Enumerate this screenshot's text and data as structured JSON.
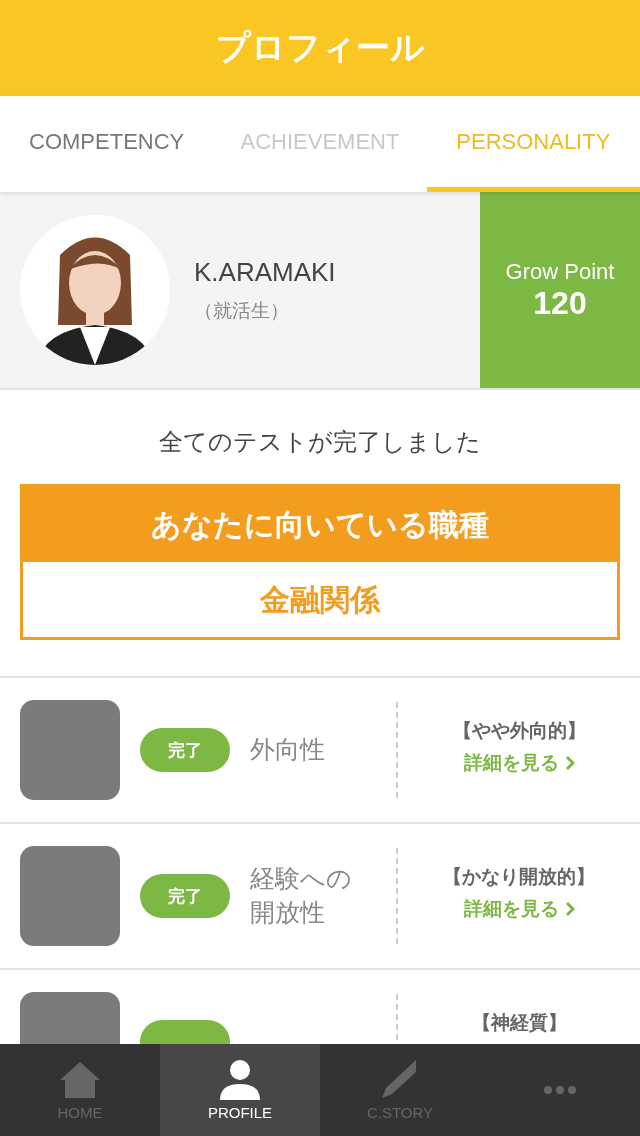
{
  "header": {
    "title": "プロフィール"
  },
  "tabs": [
    {
      "label": "COMPETENCY",
      "selected": false,
      "disabled": false
    },
    {
      "label": "ACHIEVEMENT",
      "selected": false,
      "disabled": true
    },
    {
      "label": "PERSONALITY",
      "selected": true,
      "disabled": false
    }
  ],
  "profile": {
    "name": "K.ARAMAKI",
    "status": "（就活生）",
    "points_label": "Grow Point",
    "points": "120"
  },
  "message": "全てのテストが完了しました",
  "recommendation": {
    "heading": "あなたに向いている職種",
    "value": "金融関係"
  },
  "tests": [
    {
      "badge": "完了",
      "title": "外向性",
      "result": "【やや外向的】",
      "link": "詳細を見る"
    },
    {
      "badge": "完了",
      "title": "経験への開放性",
      "result": "【かなり開放的】",
      "link": "詳細を見る"
    },
    {
      "result": "【神経質】"
    }
  ],
  "nav": [
    {
      "kind": "home",
      "label": "HOME",
      "selected": false
    },
    {
      "kind": "person",
      "label": "PROFILE",
      "selected": true
    },
    {
      "kind": "pen",
      "label": "C.STORY",
      "selected": false
    },
    {
      "kind": "more",
      "selected": false
    }
  ]
}
